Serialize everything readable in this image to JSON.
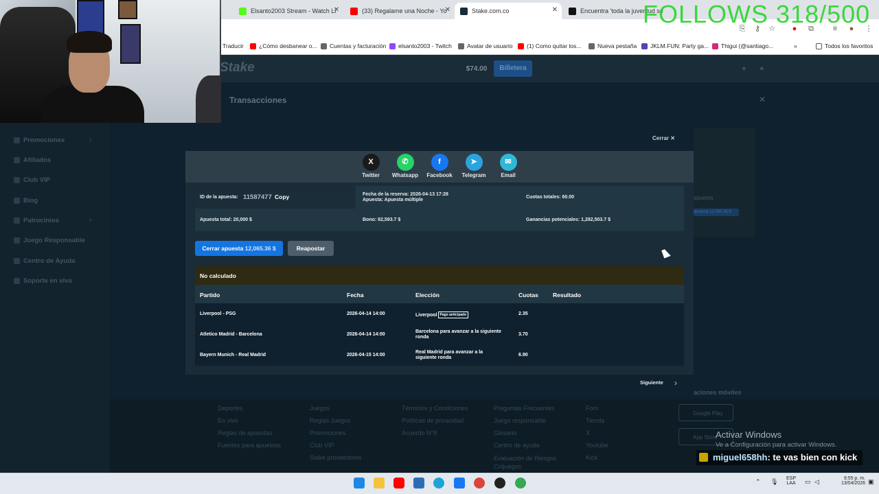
{
  "overlay": {
    "follows": "FOLLOWS 318/500",
    "chat_user": "miguel658hh",
    "chat_message": ": te vas bien con kick",
    "windows_activate_title": "Activar Windows",
    "windows_activate_sub": "Ve a Configuración para activar Windows."
  },
  "browser": {
    "tabs": [
      {
        "label": "Elsanto2003 Stream - Watch Li",
        "color": "#53fc18"
      },
      {
        "label": "(33) Regalame una Noche - Yo",
        "color": "#ff0000"
      },
      {
        "label": "Stake.com.co",
        "color": "#1a2c38"
      },
      {
        "label": "Encuentra 'toda la juventud se",
        "color": "#111111"
      }
    ],
    "bookmarks": [
      {
        "label": "Traducir",
        "color": "#ffffff"
      },
      {
        "label": "¿Cómo desbanear o...",
        "color": "#ff0000"
      },
      {
        "label": "Cuentas y facturación",
        "color": "#666666"
      },
      {
        "label": "elsanto2003 - Twitch",
        "color": "#9146ff"
      },
      {
        "label": "Avatar de usuario",
        "color": "#666666"
      },
      {
        "label": "(1) Como quitar los...",
        "color": "#ff0000"
      },
      {
        "label": "Nueva pestaña",
        "color": "#666666"
      },
      {
        "label": "JKLM.FUN: Party ga...",
        "color": "#5b3fb5"
      },
      {
        "label": "Thigui (@santiago...",
        "color": "#d62976"
      }
    ],
    "all_bookmarks": "Todos los favoritos"
  },
  "site": {
    "logo": "Stake",
    "balance": "$74.00",
    "wallet": "Billetera",
    "page_title": "Transacciones",
    "sidebar": [
      "Promociones",
      "Afiliados",
      "Club VIP",
      "Blog",
      "Patrocinios",
      "Juego Responsable",
      "Centro de Ayuda",
      "Soporte en vivo"
    ],
    "dim_panel": [
      "apuesta",
      "apuesta 12,065.36 $"
    ],
    "footer": {
      "col1": [
        "Deportes",
        "En vivo",
        "Reglas de apuestas",
        "Fuentes para apuestas"
      ],
      "col2": [
        "Juegos",
        "Reglas Juegos",
        "Promociones",
        "Club VIP",
        "Stake proveedores"
      ],
      "col3": [
        "Términos y Condiciones",
        "Políticas de privacidad",
        "Acuerdo N°8"
      ],
      "col4": [
        "Preguntas Frecuentes",
        "Juego responsable",
        "Glosario",
        "Centro de ayuda",
        "Evaluación de Riesgos Coljuegos"
      ],
      "col5": [
        "Foro",
        "Tienda",
        "X",
        "Youtube",
        "Kick"
      ],
      "apps_title": "aciones móviles",
      "google_play": "Google Play",
      "app_store": "App Store"
    }
  },
  "modal": {
    "close": "Cerrar",
    "share": [
      {
        "label": "Twitter",
        "icon": "x-icon",
        "glyph": "X",
        "color": "#1a1a1a"
      },
      {
        "label": "Whatsapp",
        "icon": "whatsapp-icon",
        "glyph": "✆",
        "color": "#25d366"
      },
      {
        "label": "Facebook",
        "icon": "facebook-icon",
        "glyph": "f",
        "color": "#1877f2"
      },
      {
        "label": "Telegram",
        "icon": "telegram-icon",
        "glyph": "➤",
        "color": "#2aa3df"
      },
      {
        "label": "Email",
        "icon": "email-icon",
        "glyph": "✉",
        "color": "#30b8d8"
      }
    ],
    "bet_id_label": "ID de la apuesta:",
    "bet_id": "11587477",
    "copy": "Copy",
    "reserve_date_label": "Fecha de la reserva:",
    "reserve_date": "2026-04-13 17:28",
    "bet_type_label": "Apuesta:",
    "bet_type": "Apuesta múltiple",
    "total_odds_label": "Cuotas totales:",
    "total_odds": "60.00",
    "total_stake_label": "Apuesta total:",
    "total_stake": "20,000 $",
    "bonus_label": "Bono:",
    "bonus": "82,593.7 $",
    "potential_label": "Ganancias potenciales:",
    "potential": "1,282,503.7 $",
    "cashout_label": "Cerrar apuesta",
    "cashout_amount": "12,065.36 $",
    "rebet": "Reapostar",
    "status": "No calculado",
    "columns": [
      "Partido",
      "Fecha",
      "Elección",
      "Cuotas",
      "Resultado"
    ],
    "rows": [
      {
        "match": "Liverpool - PSG",
        "date": "2026-04-14 14:00",
        "pick": "Liverpool",
        "tag": "Pago anticipado",
        "odds": "2.35"
      },
      {
        "match": "Atletico Madrid - Barcelona",
        "date": "2026-04-14 14:00",
        "pick": "Barcelona para avanzar a la siguiente ronda",
        "tag": "",
        "odds": "3.70"
      },
      {
        "match": "Bayern Munich - Real Madrid",
        "date": "2026-04-15 14:00",
        "pick": "Real Madrid para avanzar a la siguiente ronda",
        "tag": "",
        "odds": "6.90"
      }
    ],
    "next": "Siguiente"
  },
  "taskbar": {
    "lang": "ESP",
    "lang_sub": "LAA",
    "time": "9:55 p. m.",
    "date": "13/04/2026"
  }
}
